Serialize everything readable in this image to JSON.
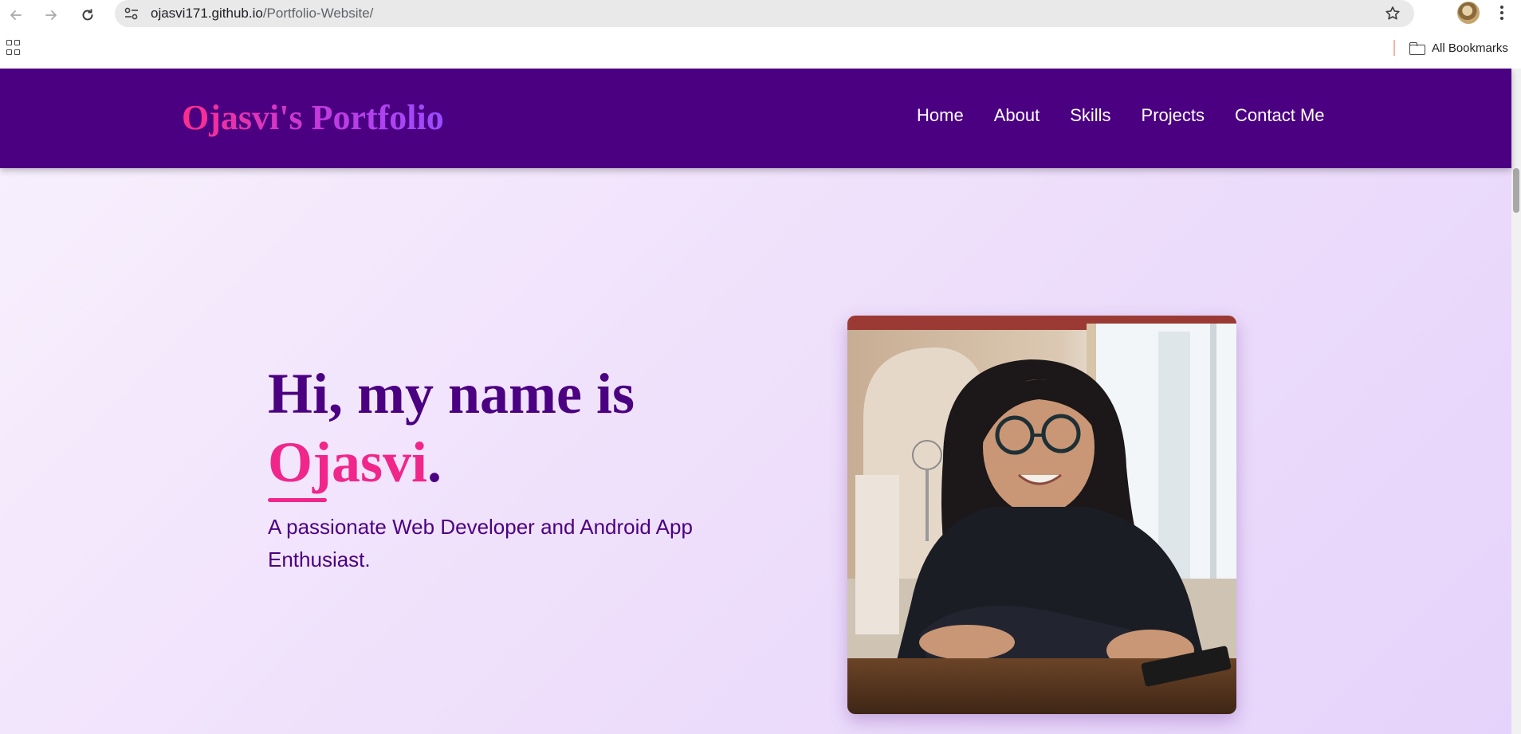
{
  "browser": {
    "url_host": "ojasvi171.github.io",
    "url_path": "/Portfolio-Website/",
    "bookmarks_label": "All Bookmarks",
    "icons": [
      "back-arrow-icon",
      "forward-arrow-icon",
      "reload-icon",
      "site-info-icon",
      "bookmark-star-icon",
      "profile-avatar",
      "kebab-menu-icon",
      "apps-grid-icon",
      "folder-icon"
    ]
  },
  "site": {
    "logo": "Ojasvi's Portfolio",
    "nav": [
      "Home",
      "About",
      "Skills",
      "Projects",
      "Contact Me"
    ],
    "hero": {
      "greeting": "Hi, my name is",
      "name": "Ojasvi",
      "period": ".",
      "subtitle": "A passionate Web Developer and Android App Enthusiast."
    },
    "colors": {
      "header_bg": "#4b0082",
      "accent_pink": "#f0268a",
      "text_purple": "#4b0082"
    }
  }
}
